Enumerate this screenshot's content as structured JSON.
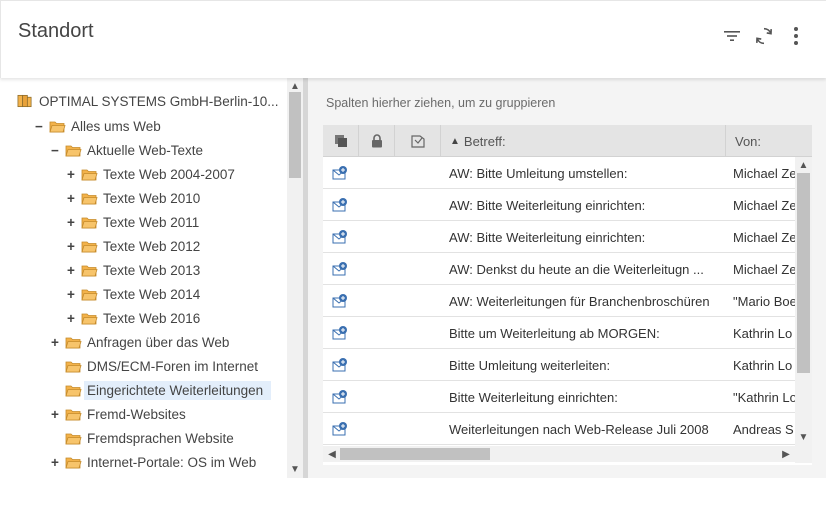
{
  "header": {
    "title": "Standort",
    "icons": [
      "filter-icon",
      "refresh-icon",
      "more-vert-icon"
    ]
  },
  "tree": {
    "root_label": "OPTIMAL SYSTEMS GmbH-Berlin-10...",
    "items": [
      {
        "label": "Alles ums Web",
        "toggle": "−"
      },
      {
        "label": "Aktuelle Web-Texte",
        "toggle": "−"
      },
      {
        "label": "Texte Web 2004-2007",
        "toggle": "+"
      },
      {
        "label": "Texte Web 2010",
        "toggle": "+"
      },
      {
        "label": "Texte Web 2011",
        "toggle": "+"
      },
      {
        "label": "Texte Web 2012",
        "toggle": "+"
      },
      {
        "label": "Texte Web 2013",
        "toggle": "+"
      },
      {
        "label": "Texte Web 2014",
        "toggle": "+"
      },
      {
        "label": "Texte Web 2016",
        "toggle": "+"
      },
      {
        "label": "Anfragen über das Web",
        "toggle": "+"
      },
      {
        "label": "DMS/ECM-Foren im Internet",
        "toggle": ""
      },
      {
        "label": "Eingerichtete Weiterleitungen",
        "toggle": ""
      },
      {
        "label": "Fremd-Websites",
        "toggle": "+"
      },
      {
        "label": "Fremdsprachen Website",
        "toggle": ""
      },
      {
        "label": "Internet-Portale: OS im Web",
        "toggle": "+"
      }
    ],
    "scroll_up": "▲",
    "scroll_down": "▼"
  },
  "grid": {
    "group_hint": "Spalten hierher ziehen, um zu gruppieren",
    "columns": {
      "sort_arrow": "▲",
      "subject": "Betreff:",
      "from": "Von:"
    },
    "rows": [
      {
        "subject": "AW: Bitte Umleitung umstellen:",
        "from": "Michael Ze"
      },
      {
        "subject": "AW: Bitte Weiterleitung einrichten:",
        "from": "Michael Ze"
      },
      {
        "subject": "AW: Bitte Weiterleitung einrichten:",
        "from": "Michael Ze"
      },
      {
        "subject": "AW: Denkst du heute an die Weiterleitugn ...",
        "from": "Michael Ze"
      },
      {
        "subject": "AW: Weiterleitungen für Branchenbroschüren",
        "from": "\"Mario Boe"
      },
      {
        "subject": "Bitte um Weiterleitung ab MORGEN:",
        "from": "Kathrin Lo"
      },
      {
        "subject": "Bitte Umleitung weiterleiten:",
        "from": "Kathrin Lo"
      },
      {
        "subject": "Bitte Weiterleitung einrichten:",
        "from": "\"Kathrin Lo"
      },
      {
        "subject": "Weiterleitungen nach Web-Release Juli 2008",
        "from": "Andreas S"
      }
    ],
    "scroll_up": "▲",
    "scroll_down": "▼",
    "scroll_left": "◀",
    "scroll_right": "▶"
  },
  "colors": {
    "selected_bg": "#e3eefb",
    "folder": "#f3b24a",
    "mail_icon": "#3a6fb0"
  }
}
